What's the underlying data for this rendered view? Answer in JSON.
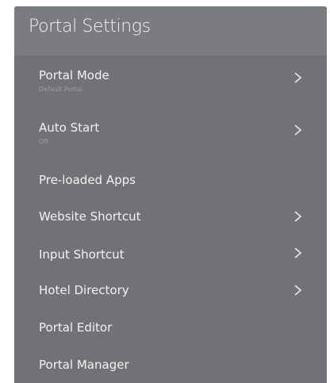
{
  "header": {
    "title": "Portal Settings"
  },
  "menu": {
    "items": [
      {
        "label": "Portal Mode",
        "value": "Default Portal",
        "has_submenu": true,
        "chevron_icon": "chevron-right-icon"
      },
      {
        "label": "Auto Start",
        "value": "Off",
        "has_submenu": true,
        "chevron_icon": "chevron-right-icon"
      },
      {
        "label": "Pre-loaded Apps",
        "has_submenu": false
      },
      {
        "label": "Website Shortcut",
        "has_submenu": true,
        "chevron_icon": "chevron-right-icon"
      },
      {
        "label": "Input Shortcut",
        "has_submenu": true,
        "chevron_icon": "chevron-right-icon"
      },
      {
        "label": "Hotel Directory",
        "has_submenu": true,
        "chevron_icon": "chevron-right-icon"
      },
      {
        "label": "Portal Editor",
        "has_submenu": false
      },
      {
        "label": "Portal Manager",
        "has_submenu": false
      }
    ]
  },
  "colors": {
    "panel_background": "#717275",
    "header_background": "#7b7c7f",
    "text_primary": "#f2f2f2",
    "text_secondary": "#9b9c9f"
  }
}
